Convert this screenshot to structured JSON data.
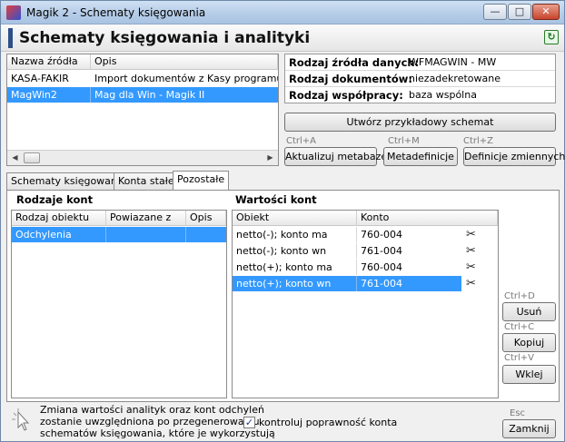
{
  "window": {
    "title": "Magik 2 - Schematy księgowania",
    "min_label": "—",
    "max_label": "□",
    "close_label": "✕"
  },
  "header": {
    "title": "Schematy księgowania i analityki",
    "refresh_icon": "↻"
  },
  "sources": {
    "columns": [
      "Nazwa źródła",
      "Opis"
    ],
    "rows": [
      [
        "KASA-FAKIR",
        "Import dokumentów z Kasy programu WF-Fa"
      ],
      [
        "MagWin2",
        "Mag dla Win - Magik II"
      ]
    ],
    "selected_index": 1
  },
  "info": {
    "rows": [
      {
        "label": "Rodzaj źródła danych:",
        "value": "WFMAGWIN - MW"
      },
      {
        "label": "Rodzaj dokumentów:",
        "value": "niezadekretowane"
      },
      {
        "label": "Rodzaj współpracy:",
        "value": "baza wspólna"
      }
    ]
  },
  "buttons": {
    "create_example": "Utwórz przykładowy schemat",
    "update_metabase": "Aktualizuj metabazę",
    "update_shortcut": "Ctrl+A",
    "metadefinitions": "Metadefinicje",
    "metadefinitions_shortcut": "Ctrl+M",
    "var_definitions": "Definicje zmiennych",
    "var_shortcut": "Ctrl+Z",
    "delete": "Usuń",
    "delete_shortcut": "Ctrl+D",
    "copy": "Kopiuj",
    "copy_shortcut": "Ctrl+C",
    "paste": "Wklej",
    "paste_shortcut": "Ctrl+V",
    "close": "Zamknij",
    "close_shortcut": "Esc"
  },
  "tabs": [
    "Schematy księgowania",
    "Konta stałe",
    "Pozostałe"
  ],
  "active_tab": 2,
  "account_types": {
    "title": "Rodzaje kont",
    "columns": [
      "Rodzaj obiektu",
      "Powiazane z",
      "Opis"
    ],
    "rows": [
      [
        "Odchylenia",
        "",
        ""
      ]
    ]
  },
  "account_values": {
    "title": "Wartości kont",
    "columns": [
      "Obiekt",
      "Konto"
    ],
    "rows": [
      [
        "netto(-); konto ma",
        "760-004"
      ],
      [
        "netto(-); konto wn",
        "761-004"
      ],
      [
        "netto(+); konto ma",
        "760-004"
      ],
      [
        "netto(+); konto wn",
        "761-004"
      ]
    ],
    "selected_index": 3
  },
  "footer": {
    "note_line1": "Zmiana wartości analityk oraz kont odchyleń",
    "note_line2": "zostanie uwzględniona po przegenerowaniu",
    "note_line3": "schematów księgowania, które je wykorzystują",
    "checkbox_label": "kontroluj poprawność konta",
    "checkbox_checked": "✓"
  },
  "colors": {
    "selection": "#3399ff",
    "titlebar": "#b6cde8"
  }
}
